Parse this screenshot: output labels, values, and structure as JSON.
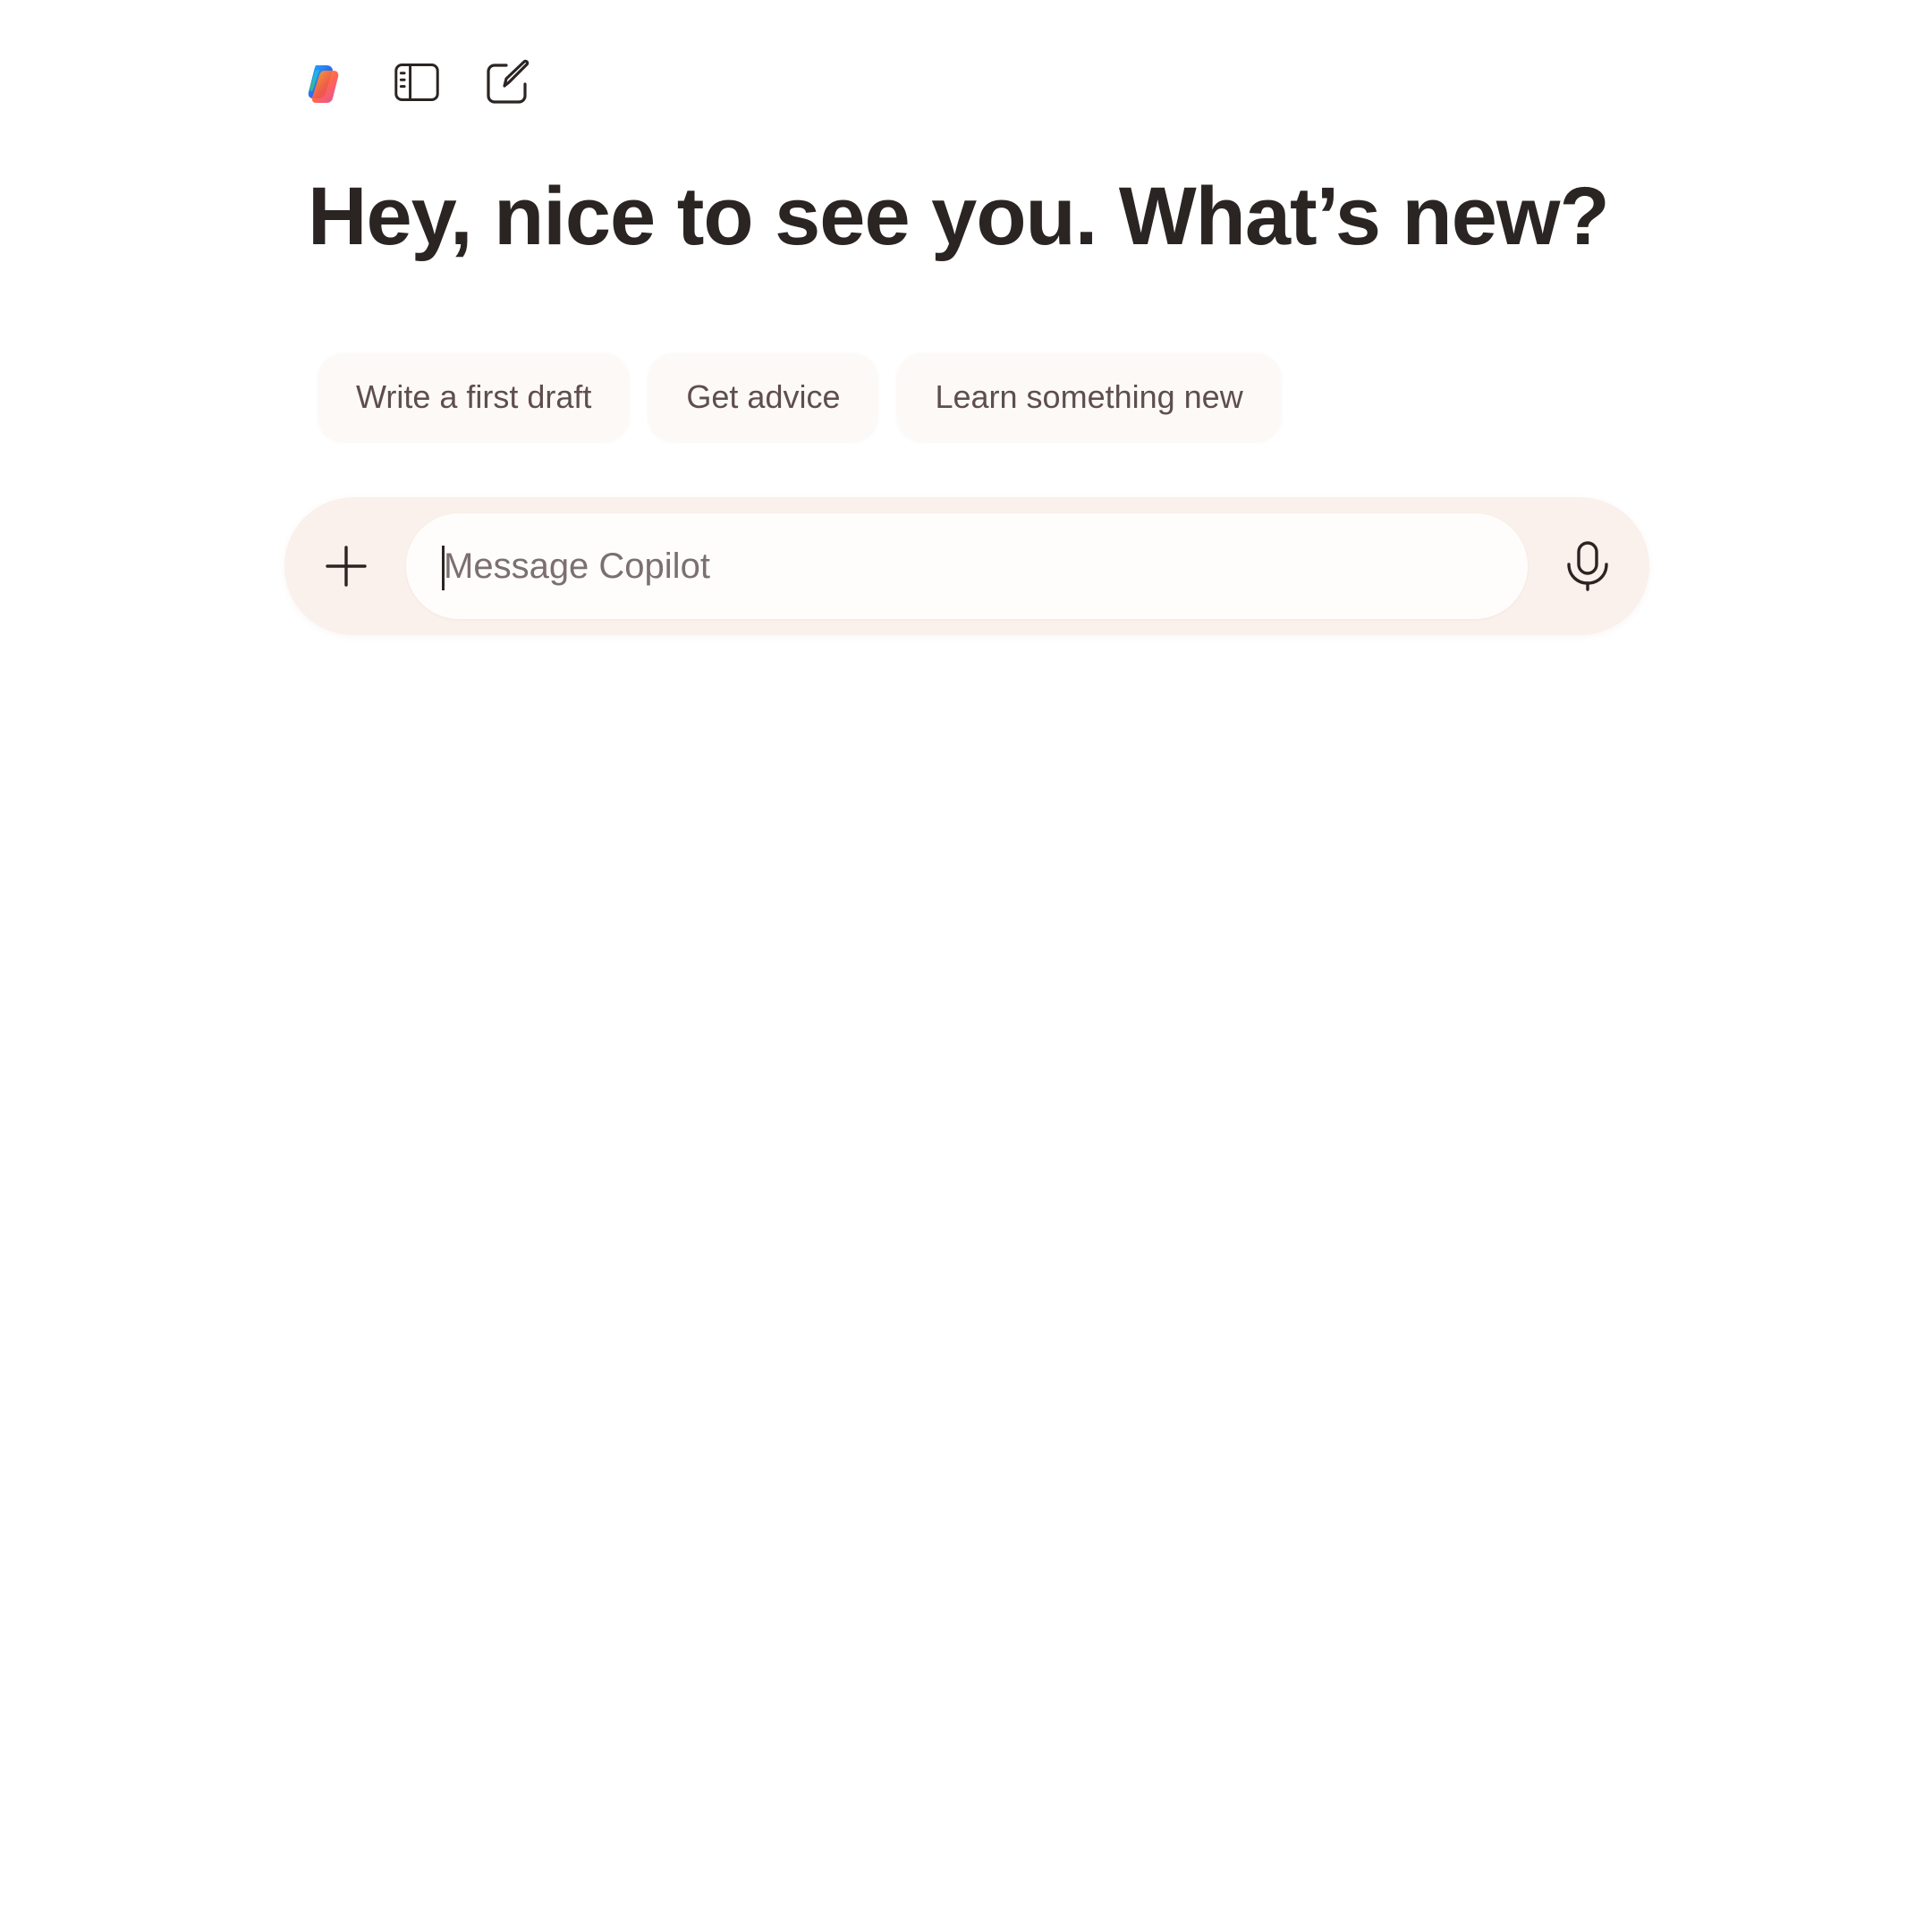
{
  "topbar": {
    "logo_icon": "copilot-logo-icon",
    "sidebar_toggle_icon": "sidebar-toggle-icon",
    "new_chat_icon": "compose-icon"
  },
  "headline": "Hey, nice to see you. What’s new?",
  "suggestions": [
    {
      "label": "Write a first draft"
    },
    {
      "label": "Get advice"
    },
    {
      "label": "Learn something new"
    }
  ],
  "composer": {
    "add_icon": "plus-icon",
    "placeholder": "Message Copilot",
    "value": "",
    "mic_icon": "microphone-icon"
  },
  "colors": {
    "text_primary": "#2a2422",
    "chip_text": "#5e4e4e",
    "chip_bg": "#fdf9f6",
    "composer_bg": "#faf0ec",
    "input_bg": "#fffdfb",
    "placeholder": "#7b7070"
  }
}
